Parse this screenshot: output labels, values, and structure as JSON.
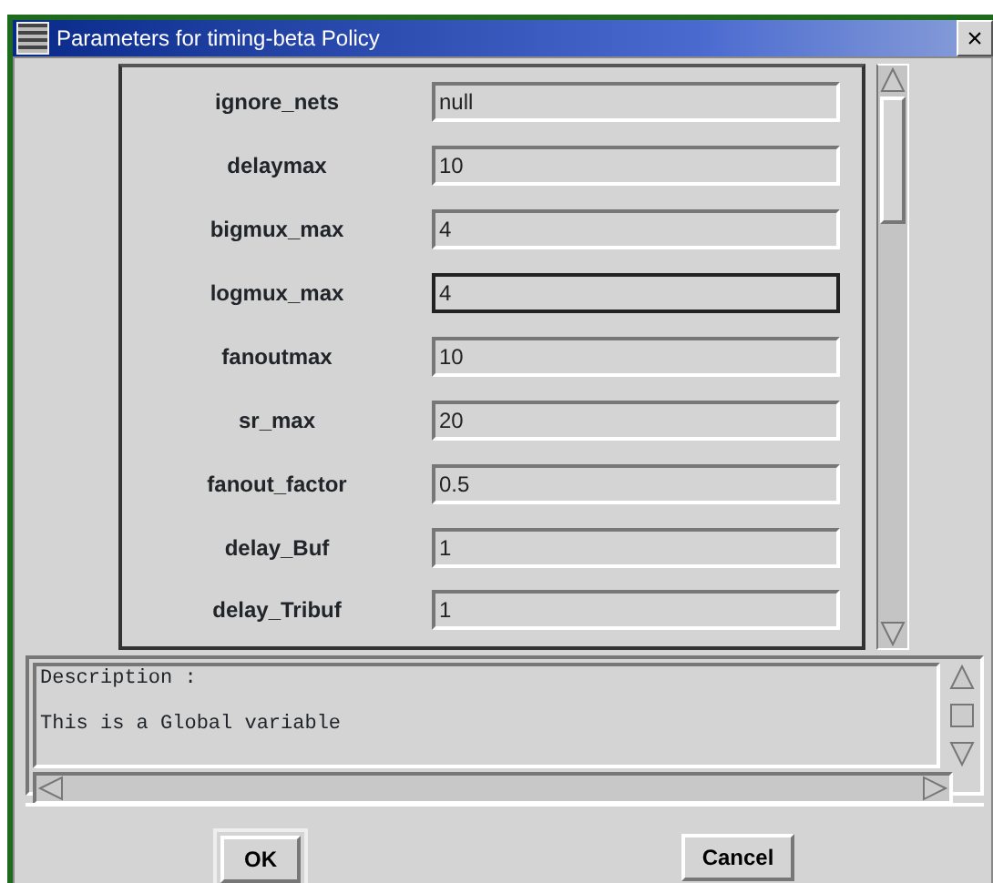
{
  "window": {
    "title": "Parameters for timing-beta Policy",
    "close": "×"
  },
  "parameters": [
    {
      "name": "ignore_nets",
      "value": "null",
      "focused": false
    },
    {
      "name": "delaymax",
      "value": "10",
      "focused": false
    },
    {
      "name": "bigmux_max",
      "value": "4",
      "focused": false
    },
    {
      "name": "logmux_max",
      "value": "4",
      "focused": true
    },
    {
      "name": "fanoutmax",
      "value": "10",
      "focused": false
    },
    {
      "name": "sr_max",
      "value": "20",
      "focused": false
    },
    {
      "name": "fanout_factor",
      "value": "0.5",
      "focused": false
    },
    {
      "name": "delay_Buf",
      "value": "1",
      "focused": false
    },
    {
      "name": "delay_Tribuf",
      "value": "1",
      "focused": false
    }
  ],
  "description": {
    "lines": [
      "Description :",
      "This is a Global variable"
    ]
  },
  "buttons": [
    {
      "label": "OK",
      "default": true
    },
    {
      "label": "Cancel",
      "default": false
    }
  ]
}
